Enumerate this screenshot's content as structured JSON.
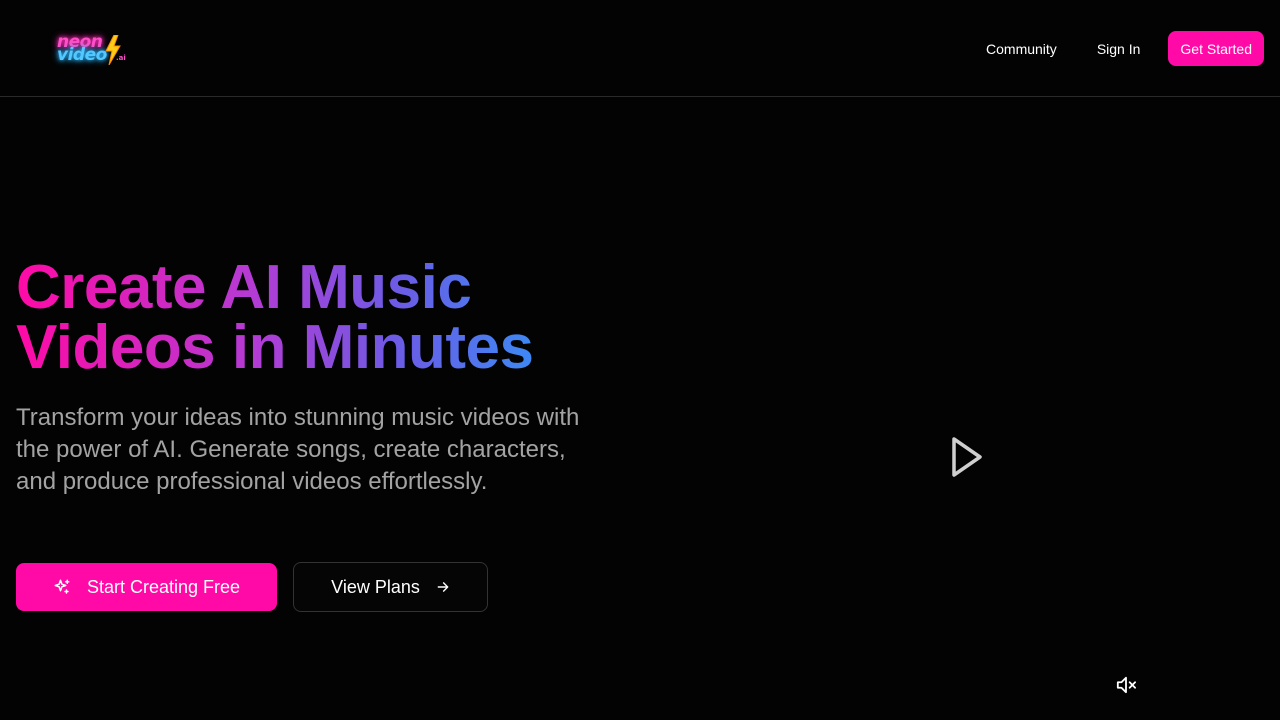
{
  "header": {
    "logo": {
      "line1": "neon",
      "line2": "video",
      "suffix": ".ai",
      "pink": "#ff4fc8",
      "blue": "#53c8ff",
      "bolt_color": "#ffcc1a"
    },
    "nav": {
      "community_label": "Community",
      "signin_label": "Sign In",
      "get_started_label": "Get Started"
    }
  },
  "hero": {
    "title": "Create AI Music Videos in Minutes",
    "subtitle": "Transform your ideas into stunning music videos with the power of AI. Generate songs, create characters, and produce professional videos effortlessly.",
    "primary_cta": {
      "label": "Start Creating Free",
      "icon": "sparkle-icon"
    },
    "secondary_cta": {
      "label": "View Plans",
      "icon": "arrow-right-icon"
    }
  },
  "video": {
    "play_icon": "play-icon",
    "mute_icon": "volume-muted-icon"
  },
  "colors": {
    "accent": "#ff0aa6",
    "background": "#030303",
    "muted_text": "#a3a3a3",
    "gradient": [
      "#ff0aa6",
      "#b43bd4",
      "#6b5ce6",
      "#2f96f8"
    ]
  }
}
